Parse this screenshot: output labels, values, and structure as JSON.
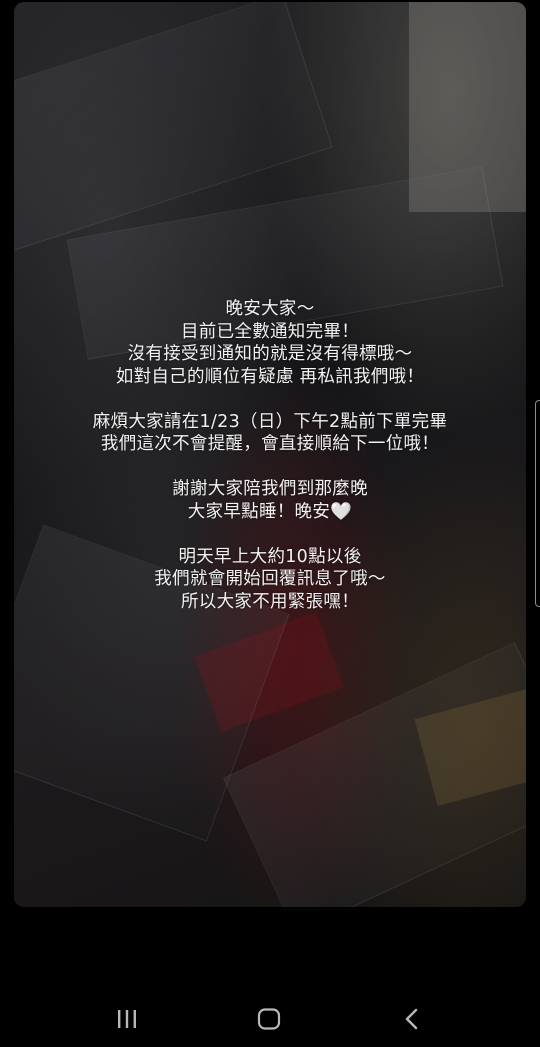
{
  "story": {
    "lines": [
      "晚安大家～",
      "目前已全數通知完畢！",
      "沒有接受到通知的就是沒有得標哦～",
      "如對自己的順位有疑慮 再私訊我們哦！",
      "",
      "麻煩大家請在1/23（日）下午2點前下單完畢",
      "我們這次不會提醒，會直接順給下一位哦！",
      "",
      "謝謝大家陪我們到那麼晚",
      "大家早點睡！晚安🤍",
      "",
      "明天早上大約10點以後",
      "我們就會開始回覆訊息了哦～",
      "所以大家不用緊張嘿！"
    ]
  },
  "background": {
    "description_icon": "photo-background"
  },
  "nav": {
    "recent_icon": "recent-apps-icon",
    "home_icon": "home-icon",
    "back_icon": "back-icon"
  },
  "colors": {
    "text": "#f2f2f2",
    "nav_background": "#000000",
    "nav_icon": "#b8b8b8"
  }
}
